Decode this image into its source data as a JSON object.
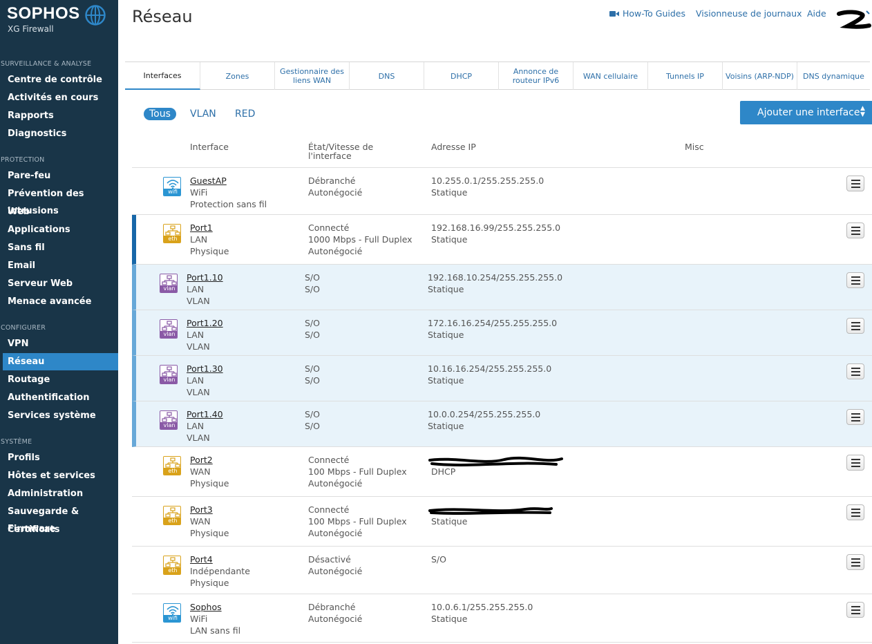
{
  "brand": {
    "name": "SOPHOS",
    "product": "XG Firewall"
  },
  "sidebar": {
    "sections": [
      {
        "title": "SURVEILLANCE & ANALYSE",
        "items": [
          "Centre de contrôle",
          "Activités en cours",
          "Rapports",
          "Diagnostics"
        ]
      },
      {
        "title": "PROTECTION",
        "items": [
          "Pare-feu",
          "Prévention des intrusions",
          "Web",
          "Applications",
          "Sans fil",
          "Email",
          "Serveur Web",
          "Menace avancée"
        ]
      },
      {
        "title": "CONFIGURER",
        "items": [
          "VPN",
          "Réseau",
          "Routage",
          "Authentification",
          "Services système"
        ]
      },
      {
        "title": "SYSTÈME",
        "items": [
          "Profils",
          "Hôtes et services",
          "Administration",
          "Sauvegarde & Firmware",
          "Certificats"
        ]
      }
    ],
    "active_item": "Réseau"
  },
  "header": {
    "title": "Réseau",
    "links": {
      "howto": "How-To Guides",
      "logs": "Visionneuse de journaux",
      "help": "Aide"
    }
  },
  "tabs": [
    "Interfaces",
    "Zones",
    "Gestionnaire des liens WAN",
    "DNS",
    "DHCP",
    "Annonce de routeur IPv6",
    "WAN cellulaire",
    "Tunnels IP",
    "Voisins (ARP-NDP)",
    "DNS dynamique"
  ],
  "active_tab": "Interfaces",
  "filters": {
    "all": "Tous",
    "vlan": "VLAN",
    "red": "RED"
  },
  "add_button": "Ajouter une interface",
  "columns": {
    "interface": "Interface",
    "state": "État/Vitesse de l'interface",
    "ip": "Adresse IP",
    "misc": "Misc"
  },
  "interfaces": [
    {
      "name": "GuestAP",
      "line2": "WiFi",
      "line3": "Protection sans fil",
      "state1": "Débranché",
      "state2": "Autonégocié",
      "state3": "",
      "ip": "10.255.0.1/255.255.255.0",
      "ip_mode": "Statique",
      "kind": "wifi"
    },
    {
      "name": "Port1",
      "line2": "LAN",
      "line3": "Physique",
      "state1": "Connecté",
      "state2": "1000 Mbps - Full Duplex",
      "state3": "Autonégocié",
      "ip": "192.168.16.99/255.255.255.0",
      "ip_mode": "Statique",
      "kind": "eth"
    },
    {
      "name": "Port1.10",
      "line2": "LAN",
      "line3": "VLAN",
      "state1": "S/O",
      "state2": "S/O",
      "state3": "",
      "ip": "192.168.10.254/255.255.255.0",
      "ip_mode": "Statique",
      "kind": "vlan"
    },
    {
      "name": "Port1.20",
      "line2": "LAN",
      "line3": "VLAN",
      "state1": "S/O",
      "state2": "S/O",
      "state3": "",
      "ip": "172.16.16.254/255.255.255.0",
      "ip_mode": "Statique",
      "kind": "vlan"
    },
    {
      "name": "Port1.30",
      "line2": "LAN",
      "line3": "VLAN",
      "state1": "S/O",
      "state2": "S/O",
      "state3": "",
      "ip": "10.16.16.254/255.255.255.0",
      "ip_mode": "Statique",
      "kind": "vlan"
    },
    {
      "name": "Port1.40",
      "line2": "LAN",
      "line3": "VLAN",
      "state1": "S/O",
      "state2": "S/O",
      "state3": "",
      "ip": "10.0.0.254/255.255.255.0",
      "ip_mode": "Statique",
      "kind": "vlan"
    },
    {
      "name": "Port2",
      "line2": "WAN",
      "line3": "Physique",
      "state1": "Connecté",
      "state2": "100 Mbps - Full Duplex",
      "state3": "Autonégocié",
      "ip": "",
      "ip_mode": "DHCP",
      "kind": "eth"
    },
    {
      "name": "Port3",
      "line2": "WAN",
      "line3": "Physique",
      "state1": "Connecté",
      "state2": "100 Mbps - Full Duplex",
      "state3": "Autonégocié",
      "ip": "",
      "ip_mode": "Statique",
      "kind": "eth"
    },
    {
      "name": "Port4",
      "line2": "Indépendante",
      "line3": "Physique",
      "state1": "Désactivé",
      "state2": "Autonégocié",
      "state3": "",
      "ip": "S/O",
      "ip_mode": "",
      "kind": "eth"
    },
    {
      "name": "Sophos",
      "line2": "WiFi",
      "line3": "LAN sans fil",
      "state1": "Débranché",
      "state2": "Autonégocié",
      "state3": "",
      "ip": "10.0.6.1/255.255.255.0",
      "ip_mode": "Statique",
      "kind": "wifi"
    }
  ],
  "icon_labels": {
    "wifi": "wifi",
    "eth": "eth",
    "vlan": "vlan"
  },
  "colors": {
    "sidebar": "#193548",
    "accent": "#2e87c8",
    "link": "#2d6fa8",
    "wifi": "#2a95d3",
    "eth": "#d9a21a",
    "vlan": "#8a5aa6",
    "vlan_row": "#e8f3fa"
  },
  "icons": {
    "brand": "globe-icon",
    "howto": "video-icon",
    "row_menu": "hamburger-menu-icon",
    "add": "updown-caret-icon"
  }
}
